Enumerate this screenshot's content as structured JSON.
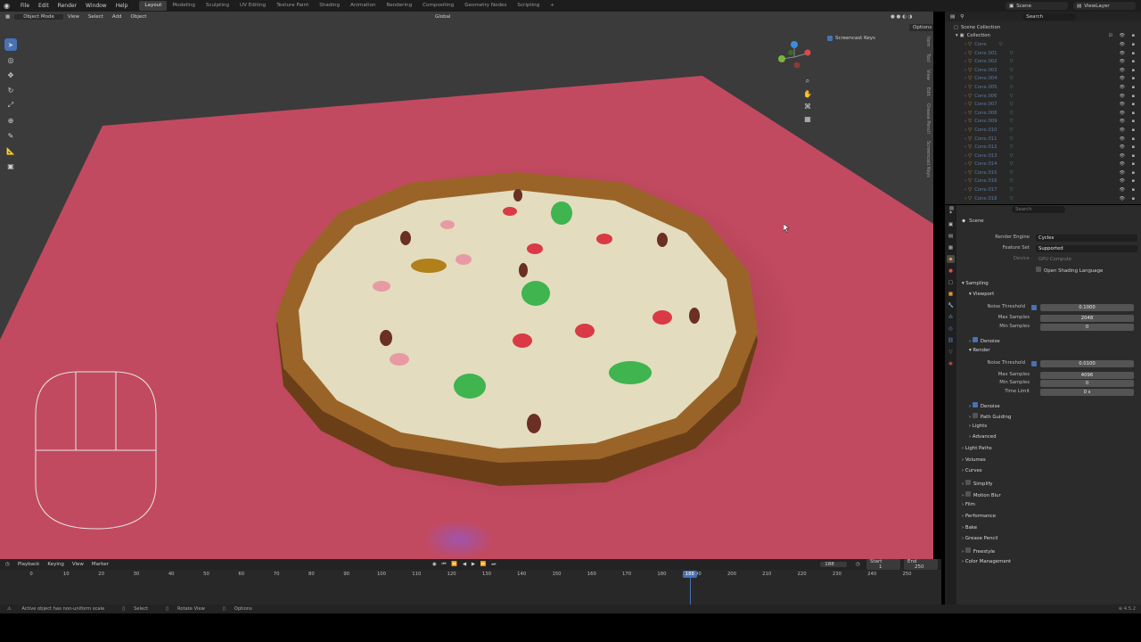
{
  "topbar": {
    "menus": [
      "File",
      "Edit",
      "Render",
      "Window",
      "Help"
    ],
    "workspaces": [
      "Layout",
      "Modeling",
      "Sculpting",
      "UV Editing",
      "Texture Paint",
      "Shading",
      "Animation",
      "Rendering",
      "Compositing",
      "Geometry Nodes",
      "Scripting"
    ],
    "active_workspace": "Layout",
    "add_tab": "+",
    "scene": "Scene",
    "view_layer": "ViewLayer"
  },
  "viewport": {
    "mode": "Object Mode",
    "menus": [
      "View",
      "Select",
      "Add",
      "Object"
    ],
    "orientation": "Global",
    "options": "Options",
    "screencast_keys": "Screencast Keys",
    "side_tabs": [
      "Item",
      "Tool",
      "View",
      "Edit",
      "Grease Pencil",
      "Screencast Keys"
    ]
  },
  "outliner": {
    "search_placeholder": "Search",
    "root": "Scene Collection",
    "collection": "Collection",
    "items": [
      "Cone",
      "Cone.001",
      "Cone.002",
      "Cone.003",
      "Cone.004",
      "Cone.005",
      "Cone.006",
      "Cone.007",
      "Cone.008",
      "Cone.009",
      "Cone.010",
      "Cone.011",
      "Cone.012",
      "Cone.013",
      "Cone.014",
      "Cone.015",
      "Cone.016",
      "Cone.017",
      "Cone.018"
    ]
  },
  "properties": {
    "search_placeholder": "Search",
    "context": "Scene",
    "render_engine_label": "Render Engine",
    "render_engine": "Cycles",
    "feature_set_label": "Feature Set",
    "feature_set": "Supported",
    "device_label": "Device",
    "device": "GPU Compute",
    "osl_label": "Open Shading Language",
    "sampling": "Sampling",
    "viewport": "Viewport",
    "noise_threshold_label": "Noise Threshold",
    "viewport_noise_threshold": "0.1000",
    "max_samples_label": "Max Samples",
    "viewport_max_samples": "2048",
    "min_samples_label": "Min Samples",
    "viewport_min_samples": "0",
    "denoise": "Denoise",
    "render": "Render",
    "render_noise_threshold": "0.0100",
    "render_max_samples": "4096",
    "render_min_samples": "0",
    "time_limit_label": "Time Limit",
    "time_limit": "0 s",
    "path_guiding": "Path Guiding",
    "lights": "Lights",
    "advanced": "Advanced",
    "sections": [
      "Light Paths",
      "Volumes",
      "Curves",
      "Simplify",
      "Motion Blur",
      "Film",
      "Performance",
      "Bake",
      "Grease Pencil",
      "Freestyle",
      "Color Management"
    ]
  },
  "timeline": {
    "menus": [
      "Playback",
      "Keying",
      "View",
      "Marker"
    ],
    "current_frame": "188",
    "start_label": "Start",
    "start": "1",
    "end_label": "End",
    "end": "250",
    "ticks": [
      "0",
      "10",
      "20",
      "30",
      "40",
      "50",
      "60",
      "70",
      "80",
      "90",
      "100",
      "110",
      "120",
      "130",
      "140",
      "150",
      "160",
      "170",
      "180",
      "190",
      "200",
      "210",
      "220",
      "230",
      "240",
      "250"
    ],
    "playhead": "188"
  },
  "statusbar": {
    "warning": "Active object has non-uniform scale",
    "select": "Select",
    "rotate": "Rotate View",
    "options": "Options",
    "version": "4.5.2"
  },
  "colors": {
    "accent": "#4772b3",
    "plane": "#c44a60",
    "crust": "#8a5a22",
    "cheese": "#e3dcbf"
  }
}
